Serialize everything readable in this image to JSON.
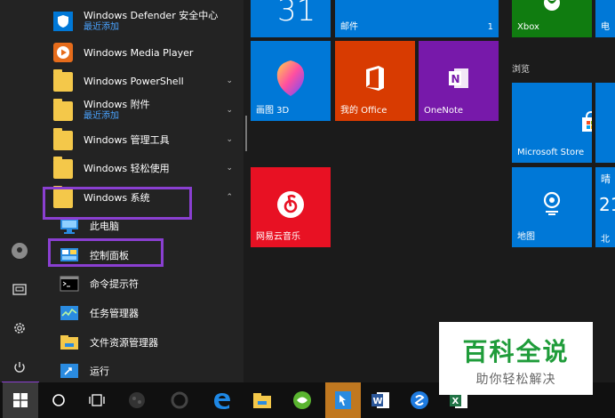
{
  "applist": {
    "items": [
      {
        "label": "Windows Defender 安全中心",
        "sub": "最近添加"
      },
      {
        "label": "Windows Media Player"
      },
      {
        "label": "Windows PowerShell"
      },
      {
        "label": "Windows 附件",
        "sub": "最近添加"
      },
      {
        "label": "Windows 管理工具"
      },
      {
        "label": "Windows 轻松使用"
      },
      {
        "label": "Windows 系统"
      },
      {
        "label": "此电脑"
      },
      {
        "label": "控制面板"
      },
      {
        "label": "命令提示符"
      },
      {
        "label": "任务管理器"
      },
      {
        "label": "文件资源管理器"
      },
      {
        "label": "运行"
      }
    ]
  },
  "tiles": {
    "calendar_day": "31",
    "mail": "邮件",
    "mail_count": "1",
    "xbox": "Xbox",
    "partial_top": "电",
    "section_browse": "浏览",
    "paint3d": "画图 3D",
    "office": "我的 Office",
    "onenote": "OneNote",
    "store": "Microsoft Store",
    "netease": "网易云音乐",
    "maps": "地图",
    "weather_partial_1": "晴",
    "weather_partial_2": "21",
    "weather_partial_3": "北京"
  },
  "watermark": {
    "main": "百科全说",
    "sub": "助你轻松解决"
  },
  "colors": {
    "highlight": "#8a3fd1",
    "tile_blue": "#0078d7",
    "tile_orange": "#d83b01",
    "tile_purple": "#7719aa",
    "tile_red": "#e81123",
    "tile_green": "#107c10",
    "watermark_green": "#1f9c3a"
  }
}
